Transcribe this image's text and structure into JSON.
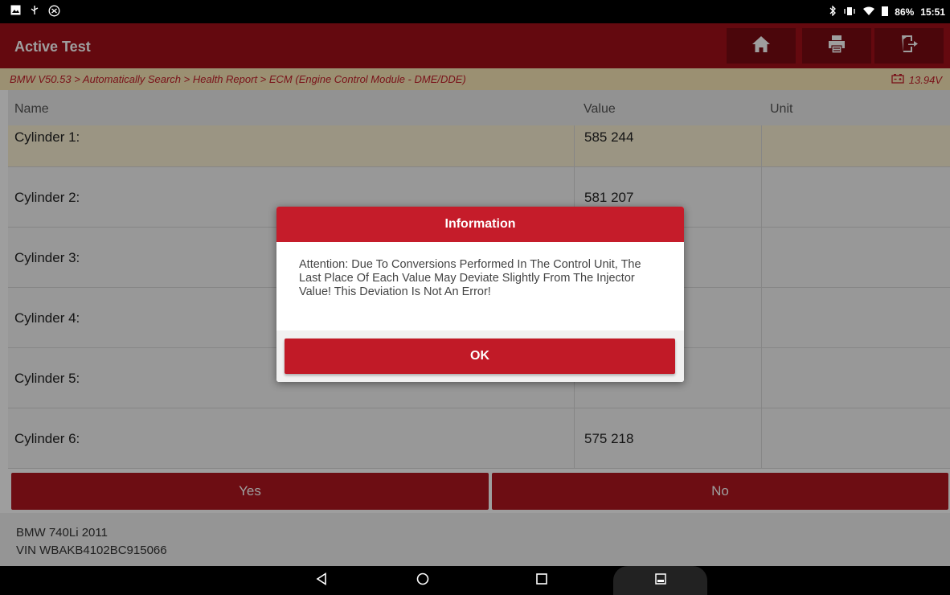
{
  "status_bar": {
    "left_icons": [
      "image-icon",
      "usb-icon",
      "accessibility-icon"
    ],
    "battery": "86%",
    "time": "15:51"
  },
  "header": {
    "title": "Active Test",
    "buttons": [
      "home-icon",
      "print-icon",
      "exit-icon"
    ]
  },
  "breadcrumb": {
    "path": "BMW V50.53 > Automatically Search > Health Report > ECM (Engine Control Module - DME/DDE)",
    "voltage": "13.94V"
  },
  "table": {
    "columns": [
      "Name",
      "Value",
      "Unit"
    ],
    "rows": [
      {
        "name": "Cylinder 1:",
        "value": "585 244",
        "unit": ""
      },
      {
        "name": "Cylinder 2:",
        "value": "581 207",
        "unit": ""
      },
      {
        "name": "Cylinder 3:",
        "value": "",
        "unit": ""
      },
      {
        "name": "Cylinder 4:",
        "value": "",
        "unit": ""
      },
      {
        "name": "Cylinder 5:",
        "value": "",
        "unit": ""
      },
      {
        "name": "Cylinder 6:",
        "value": "575 218",
        "unit": ""
      }
    ]
  },
  "actions": {
    "yes": "Yes",
    "no": "No"
  },
  "footer": {
    "vehicle": "BMW 740Li 2011",
    "vin": "VIN WBAKB4102BC915066"
  },
  "dialog": {
    "title": "Information",
    "message": "Attention: Due To Conversions Performed In The Control Unit, The Last Place Of Each Value May Deviate Slightly From The Injector Value! This Deviation Is Not An Error!",
    "ok_label": "OK"
  },
  "colors": {
    "brand_red": "#a20f19",
    "dialog_red": "#c51c2a",
    "breadcrumb_bg": "#fbe9b8"
  }
}
